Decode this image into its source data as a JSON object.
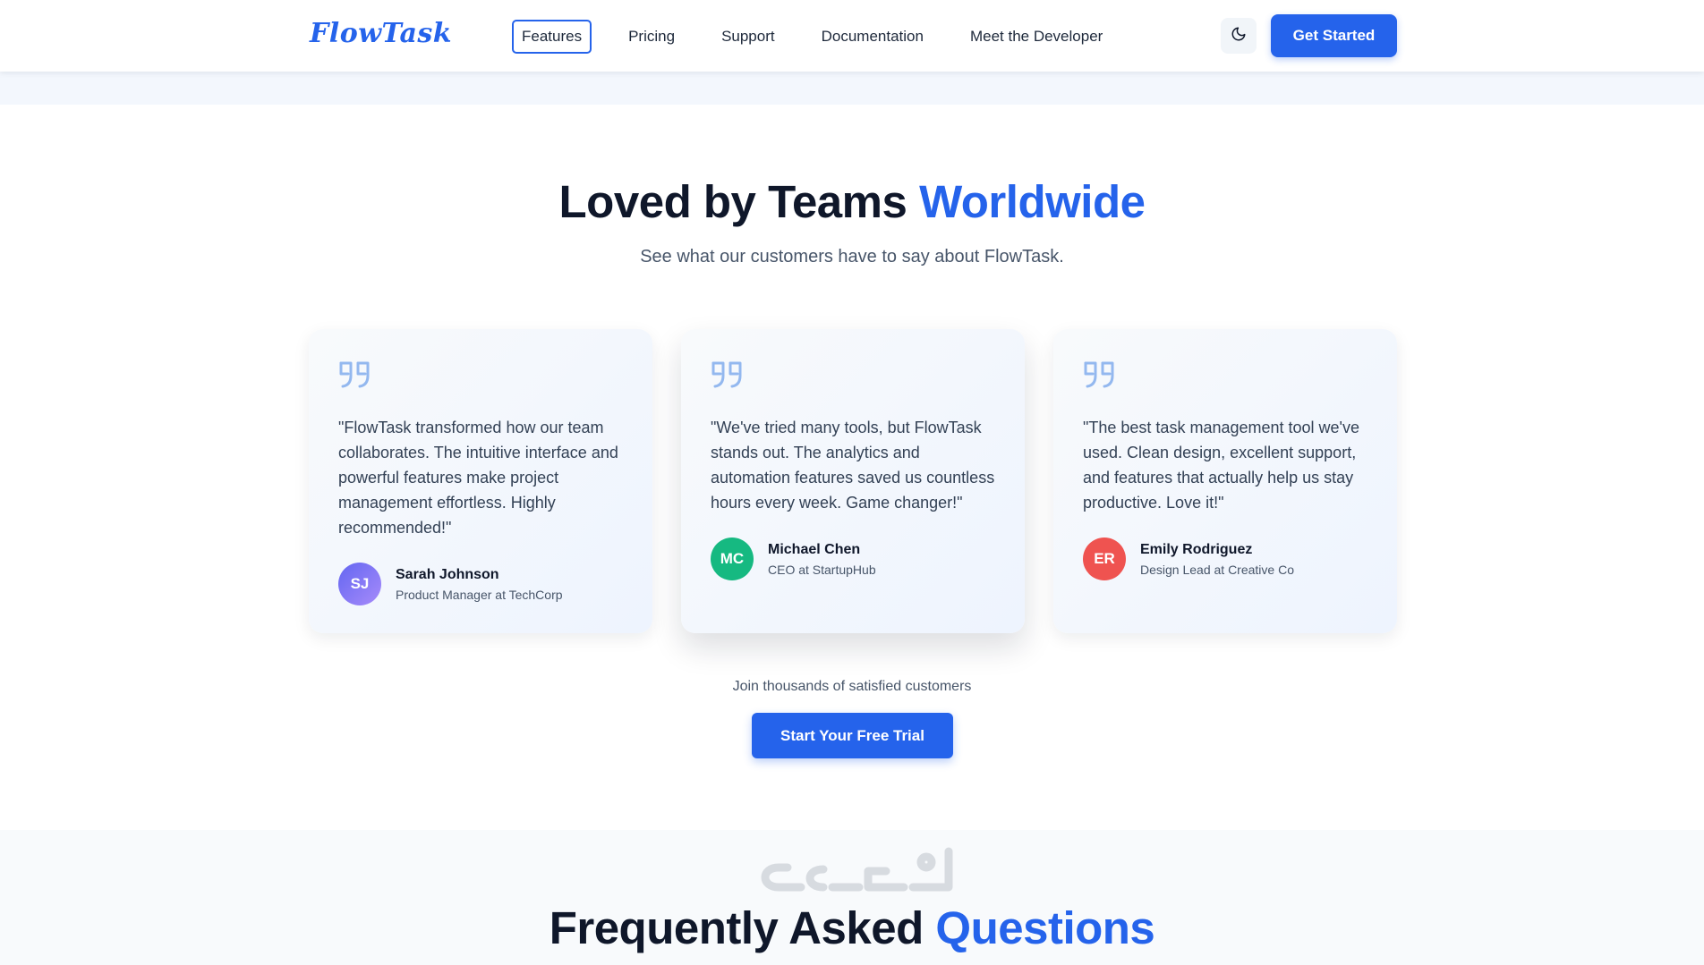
{
  "brand": {
    "logo": "FlowTask",
    "accent_color": "#2563eb"
  },
  "nav": {
    "links": [
      {
        "label": "Features",
        "active": true
      },
      {
        "label": "Pricing",
        "active": false
      },
      {
        "label": "Support",
        "active": false
      },
      {
        "label": "Documentation",
        "active": false
      },
      {
        "label": "Meet the Developer",
        "active": false
      }
    ],
    "theme_toggle_icon": "moon-icon",
    "cta_label": "Get Started"
  },
  "testimonials": {
    "title_main": "Loved by Teams",
    "title_accent": "Worldwide",
    "subtitle": "See what our customers have to say about FlowTask.",
    "quote_icon": "quote-icon",
    "cards": [
      {
        "quote": "\"FlowTask transformed how our team collaborates. The intuitive interface and powerful features make project management effortless. Highly recommended!\"",
        "initials": "SJ",
        "name": "Sarah Johnson",
        "role": "Product Manager at TechCorp",
        "avatar_color": "#7c6cf0"
      },
      {
        "quote": "\"We've tried many tools, but FlowTask stands out. The analytics and automation features saved us countless hours every week. Game changer!\"",
        "initials": "MC",
        "name": "Michael Chen",
        "role": "CEO at StartupHub",
        "avatar_color": "#16b981"
      },
      {
        "quote": "\"The best task management tool we've used. Clean design, excellent support, and features that actually help us stay productive. Love it!\"",
        "initials": "ER",
        "name": "Emily Rodriguez",
        "role": "Design Lead at Creative Co",
        "avatar_color": "#ef5350"
      }
    ],
    "join_text": "Join thousands of satisfied customers",
    "trial_cta": "Start Your Free Trial"
  },
  "faq": {
    "title_main": "Frequently Asked",
    "title_accent": "Questions"
  }
}
